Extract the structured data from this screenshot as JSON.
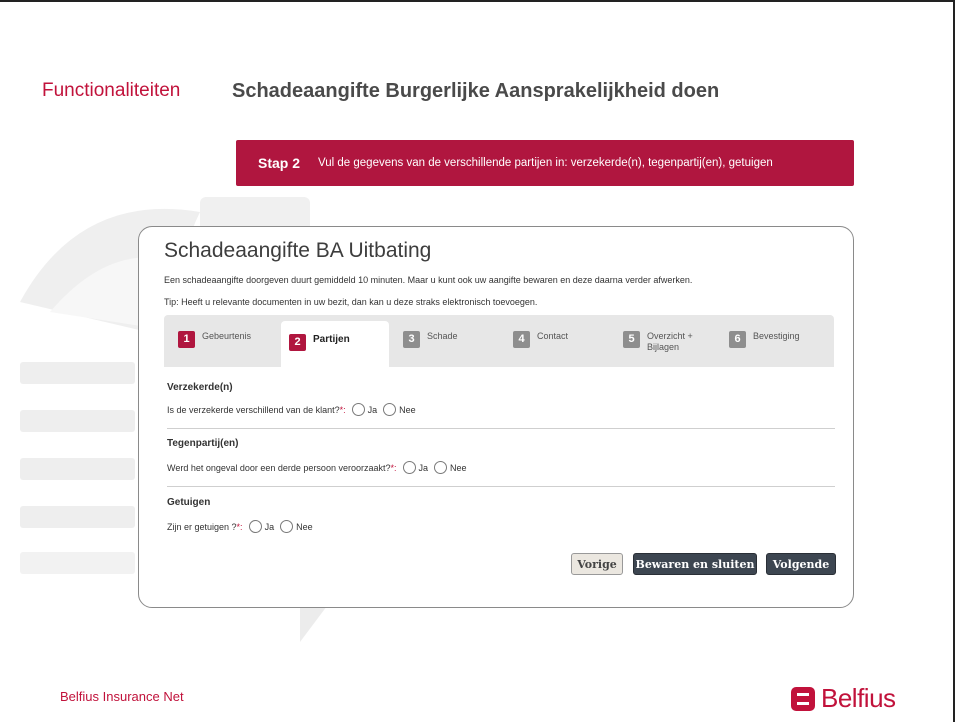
{
  "slide": {
    "section": "Functionaliteiten",
    "title": "Schadeaangifte Burgerlijke Aansprakelijkheid doen"
  },
  "banner": {
    "step": "Stap 2",
    "text": "Vul de gegevens van de verschillende partijen in: verzekerde(n), tegenpartij(en), getuigen",
    "color": "#b0163f"
  },
  "card": {
    "title": "Schadeaangifte BA Uitbating",
    "intro": "Een schadeaangifte doorgeven duurt gemiddeld 10 minuten. Maar u kunt ook uw aangifte bewaren en deze daarna verder afwerken.",
    "tip": "Tip: Heeft u relevante documenten in uw bezit, dan kan u deze straks elektronisch toevoegen."
  },
  "tabs": [
    {
      "num": "1",
      "label": "Gebeurtenis"
    },
    {
      "num": "2",
      "label": "Partijen"
    },
    {
      "num": "3",
      "label": "Schade"
    },
    {
      "num": "4",
      "label": "Contact"
    },
    {
      "num": "5",
      "label": "Overzicht + Bijlagen"
    },
    {
      "num": "6",
      "label": "Bevestiging"
    }
  ],
  "groups": [
    {
      "title": "Verzekerde(n)",
      "question": "Is de verzekerde verschillend van de klant?",
      "required": "*:",
      "yes": "Ja",
      "no": "Nee"
    },
    {
      "title": "Tegenpartij(en)",
      "question": "Werd het ongeval door een derde persoon veroorzaakt?",
      "required": "*:",
      "yes": "Ja",
      "no": "Nee"
    },
    {
      "title": "Getuigen",
      "question": "Zijn er getuigen ?",
      "required": "*:",
      "yes": "Ja",
      "no": "Nee"
    }
  ],
  "buttons": {
    "prev": "Vorige",
    "save": "Bewaren en sluiten",
    "next": "Volgende"
  },
  "footer": {
    "text": "Belfius Insurance Net",
    "logo": "Belfius",
    "brand_color": "#c1123b"
  }
}
